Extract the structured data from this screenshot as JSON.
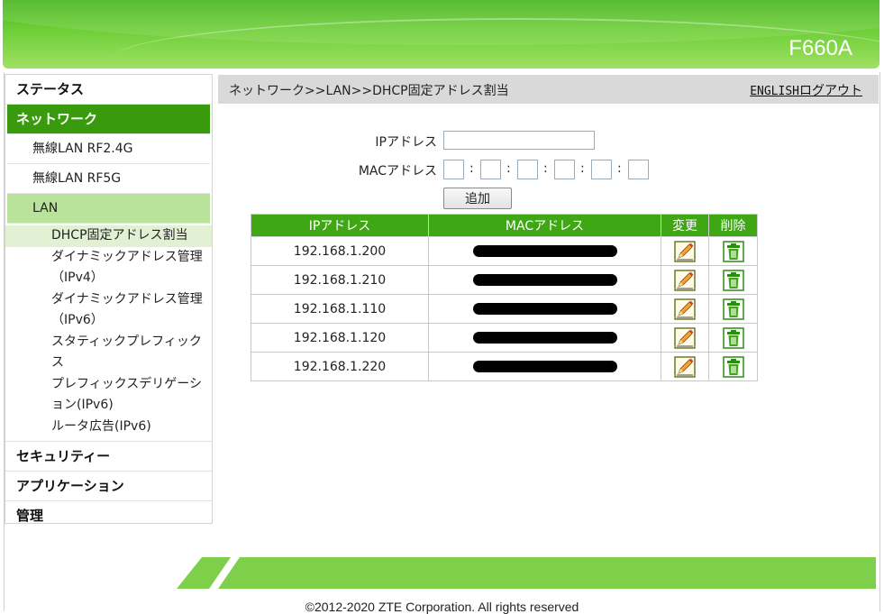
{
  "header": {
    "model": "F660A"
  },
  "sidebar": {
    "status": "ステータス",
    "network": "ネットワーク",
    "subs": [
      "無線LAN RF2.4G",
      "無線LAN RF5G",
      "LAN"
    ],
    "leaves": [
      "DHCP固定アドレス割当",
      "ダイナミックアドレス管理（IPv4）",
      "ダイナミックアドレス管理（IPv6）",
      "スタティックプレフィックス",
      "プレフィックスデリゲーション(IPv6)",
      "ルータ広告(IPv6)"
    ],
    "security": "セキュリティー",
    "application": "アプリケーション",
    "admin": "管理"
  },
  "titlebar": {
    "breadcrumb": "ネットワーク>>LAN>>DHCP固定アドレス割当",
    "english": "ENGLISH",
    "logout": "ログアウト"
  },
  "form": {
    "ip_label": "IPアドレス",
    "ip_value": "",
    "mac_label": "MACアドレス",
    "mac_values": [
      "",
      "",
      "",
      "",
      "",
      ""
    ],
    "add_label": "追加"
  },
  "table": {
    "headers": {
      "ip": "IPアドレス",
      "mac": "MACアドレス",
      "edit": "変更",
      "delete": "削除"
    },
    "rows": [
      {
        "ip": "192.168.1.200",
        "mac": ""
      },
      {
        "ip": "192.168.1.210",
        "mac": ""
      },
      {
        "ip": "192.168.1.110",
        "mac": ""
      },
      {
        "ip": "192.168.1.120",
        "mac": ""
      },
      {
        "ip": "192.168.1.220",
        "mac": ""
      }
    ]
  },
  "footer": {
    "copyright": "©2012-2020 ZTE Corporation. All rights reserved"
  },
  "colors": {
    "brand_green": "#3fa614",
    "active_menu": "#3a9a0e",
    "sub_active": "#b9e29a"
  }
}
